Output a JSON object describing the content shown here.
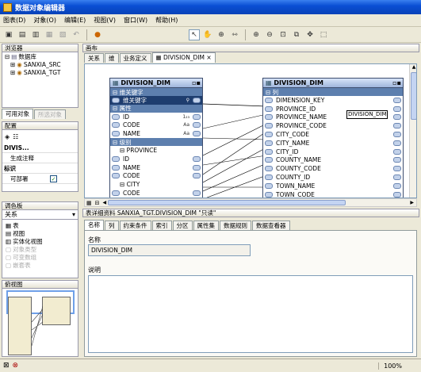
{
  "window": {
    "title": "数据对象编辑器"
  },
  "menu": [
    "图表(D)",
    "对象(O)",
    "编辑(E)",
    "视图(V)",
    "窗口(W)",
    "帮助(H)"
  ],
  "browser": {
    "title": "浏览器",
    "root": "数据库",
    "items": [
      "SANXIA_SRC",
      "SANXIA_TGT"
    ],
    "tabs": [
      "可用对象",
      "所选对象"
    ]
  },
  "config": {
    "title": "配置",
    "rows": [
      {
        "label": "DIVIS...",
        "value": ""
      },
      {
        "label": "生成注释",
        "value": ""
      },
      {
        "label": "标识",
        "value": ""
      },
      {
        "label": "可部署",
        "value": "✓"
      }
    ]
  },
  "palette": {
    "title": "调色板",
    "dropdown": "关系",
    "items": [
      {
        "label": "表",
        "enabled": true
      },
      {
        "label": "视图",
        "enabled": true
      },
      {
        "label": "实体化视图",
        "enabled": true
      },
      {
        "label": "对象类型",
        "enabled": false
      },
      {
        "label": "可变数组",
        "enabled": false
      },
      {
        "label": "嵌套表",
        "enabled": false
      }
    ]
  },
  "birdseye": {
    "title": "俯视图"
  },
  "canvas": {
    "title": "画布",
    "tabs": [
      "关系",
      "维",
      "业务定义",
      "DIVISION_DIM"
    ],
    "active_tab_close": "×"
  },
  "dim_table": {
    "name": "DIVISION_DIM",
    "sections": [
      {
        "header": "⊟ 维关键字",
        "rows": [
          "维关键字"
        ]
      },
      {
        "header": "⊟ 属性",
        "rows": [
          "ID",
          "CODE",
          "NAME"
        ]
      },
      {
        "header": "⊟ 级别",
        "rows": [
          "⊟ PROVINCE",
          "ID",
          "NAME",
          "CODE",
          "⊟ CITY",
          "CODE"
        ]
      }
    ]
  },
  "table2": {
    "name": "DIVISION_DIM",
    "section": "⊟ 列",
    "columns": [
      "DIMENSION_KEY",
      "PROVINCE_ID",
      "PROVINCE_NAME",
      "PROVINCE_CODE",
      "CITY_CODE",
      "CITY_NAME",
      "CITY_ID",
      "COUNTY_NAME",
      "COUNTY_CODE",
      "COUNTY_ID",
      "TOWN_NAME",
      "TOWN_CODE"
    ],
    "tooltip": "DIVISION_DIM"
  },
  "details": {
    "title": "表详细资料 SANXIA_TGT.DIVISION_DIM \"只读\"",
    "tabs": [
      "名称",
      "列",
      "约束条件",
      "索引",
      "分区",
      "属性集",
      "数据规则",
      "数据查看器"
    ],
    "name_label": "名称",
    "name_value": "DIVISION_DIM",
    "desc_label": "说明",
    "desc_value": ""
  },
  "status": {
    "zoom": "100%"
  }
}
